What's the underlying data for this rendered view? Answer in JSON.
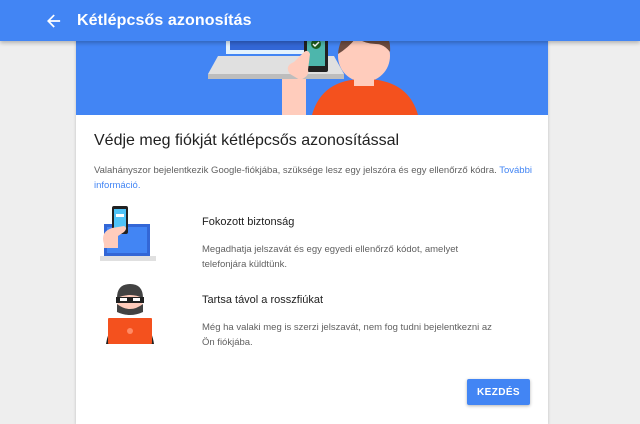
{
  "appbar": {
    "title": "Kétlépcsős azonosítás"
  },
  "main": {
    "heading": "Védje meg fiókját kétlépcsős azonosítással",
    "intro_text": "Valahányszor bejelentkezik Google-fiókjába, szüksége lesz egy jelszóra és egy ellenőrző kódra. ",
    "learn_more_link": "További információ."
  },
  "features": [
    {
      "icon": "phone-laptop-icon",
      "title": "Fokozott biztonság",
      "description": "Megadhatja jelszavát és egy egyedi ellenőrző kódot, amelyet telefonjára küldtünk."
    },
    {
      "icon": "hacker-icon",
      "title": "Tartsa távol a rosszfiúkat",
      "description": "Még ha valaki meg is szerzi jelszavát, nem fog tudni bejelentkezni az Ön fiókjába."
    }
  ],
  "actions": {
    "start_label": "KEZDÉS"
  },
  "colors": {
    "primary": "#4285f4",
    "accent_orange": "#f4511e"
  }
}
